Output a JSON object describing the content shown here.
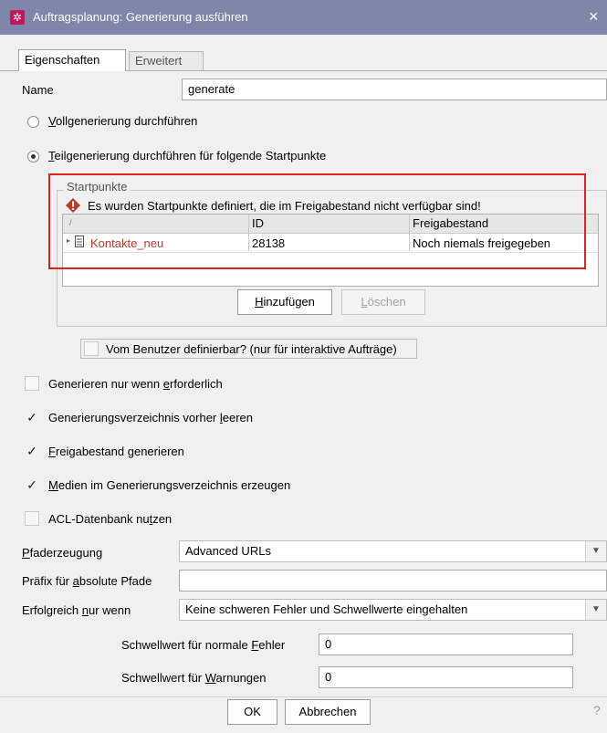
{
  "window": {
    "title": "Auftragsplanung: Generierung ausführen",
    "close": "×",
    "icon": "gear-icon"
  },
  "tabs": [
    {
      "label": "Eigenschaften",
      "active": true
    },
    {
      "label": "Erweitert",
      "active": false
    }
  ],
  "name": {
    "label": "Name",
    "value": "generate"
  },
  "radios": {
    "full": {
      "label_u": "V",
      "label_rest": "ollgenerierung durchführen",
      "checked": false
    },
    "partial": {
      "label_u": "T",
      "label_rest": "eilgenerierung durchführen für folgende Startpunkte",
      "checked": true
    }
  },
  "startpoints": {
    "group_title": "Startpunkte",
    "warning": "Es wurden Startpunkte definiert, die im Freigabestand nicht verfügbar sind!",
    "columns": [
      "",
      "ID",
      "Freigabestand"
    ],
    "rows": [
      {
        "name": "Kontakte_neu",
        "id": "28138",
        "status": "Noch niemals freigegeben"
      }
    ],
    "add_button": {
      "u": "H",
      "rest": "inzufügen"
    },
    "delete_button": {
      "u": "L",
      "rest": "öschen"
    }
  },
  "user_definable": {
    "label": "Vom Benutzer definierbar? (nur für interaktive Aufträge)",
    "checked": false
  },
  "checkboxes": [
    {
      "pre": "Generieren nur wenn ",
      "u": "e",
      "post": "rforderlich",
      "checked": false
    },
    {
      "pre": "Generierungsverzeichnis vorher ",
      "u": "l",
      "post": "eeren",
      "checked": true
    },
    {
      "pre": "",
      "u": "F",
      "post": "reigabestand generieren",
      "checked": true
    },
    {
      "pre": "",
      "u": "M",
      "post": "edien im Generierungsverzeichnis erzeugen",
      "checked": true
    },
    {
      "pre": "ACL-Datenbank nu",
      "u": "t",
      "post": "zen",
      "checked": false
    }
  ],
  "check_mark": "✓",
  "path_generation": {
    "label_u": "P",
    "label_rest": "faderzeugung",
    "value": "Advanced URLs"
  },
  "prefix": {
    "label_pre": "Präfix für ",
    "label_u": "a",
    "label_post": "bsolute Pfade",
    "value": ""
  },
  "success_only_if": {
    "label_pre": "Erfolgreich ",
    "label_u": "n",
    "label_post": "ur wenn",
    "value": "Keine schweren Fehler und Schwellwerte eingehalten"
  },
  "threshold_errors": {
    "label_pre": "Schwellwert für normale ",
    "label_u": "F",
    "label_post": "ehler",
    "value": "0"
  },
  "threshold_warnings": {
    "label_pre": "Schwellwert für ",
    "label_u": "W",
    "label_post": "arnungen",
    "value": "0"
  },
  "footer": {
    "ok": "OK",
    "cancel": "Abbrechen",
    "help": "?"
  },
  "colors": {
    "titlebar": "#7e86a9",
    "highlight": "#d22222",
    "link_red": "#c0392b"
  }
}
